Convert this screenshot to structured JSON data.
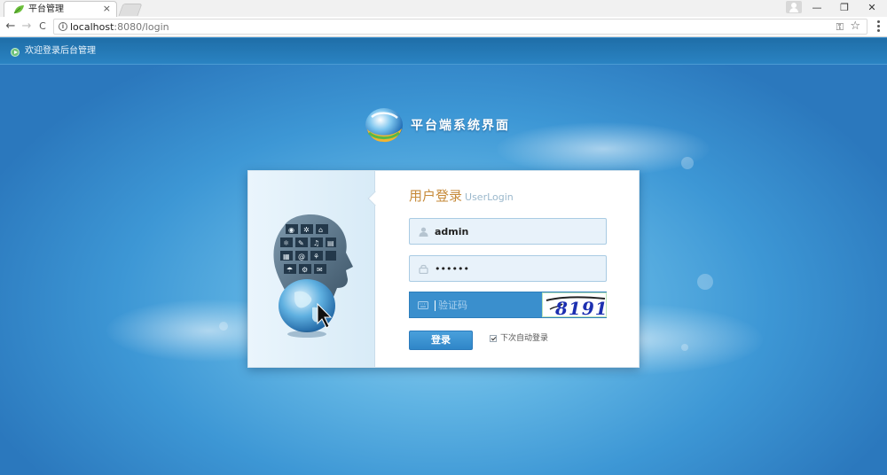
{
  "browser": {
    "tab_title": "平台管理",
    "tab_close": "×",
    "url_host": "localhost",
    "url_rest": ":8080/login",
    "window_controls": {
      "minimize": "—",
      "maximize": "❐",
      "close": "✕"
    },
    "nav": {
      "back": "←",
      "forward": "→",
      "reload": "C"
    }
  },
  "header": {
    "welcome_text": "欢迎登录后台管理"
  },
  "logo": {
    "text": "平台端系统界面"
  },
  "login": {
    "title": "用户登录",
    "subtitle": "UserLogin",
    "username_value": "admin",
    "password_value": "••••••",
    "captcha_placeholder": "验证码",
    "captcha_text": "8191",
    "submit_label": "登录",
    "remember_label": "下次自动登录",
    "remember_checked": true
  },
  "colors": {
    "accent": "#3a8fcd",
    "title": "#c68a3a",
    "header_bar": "#1f6ea8"
  }
}
